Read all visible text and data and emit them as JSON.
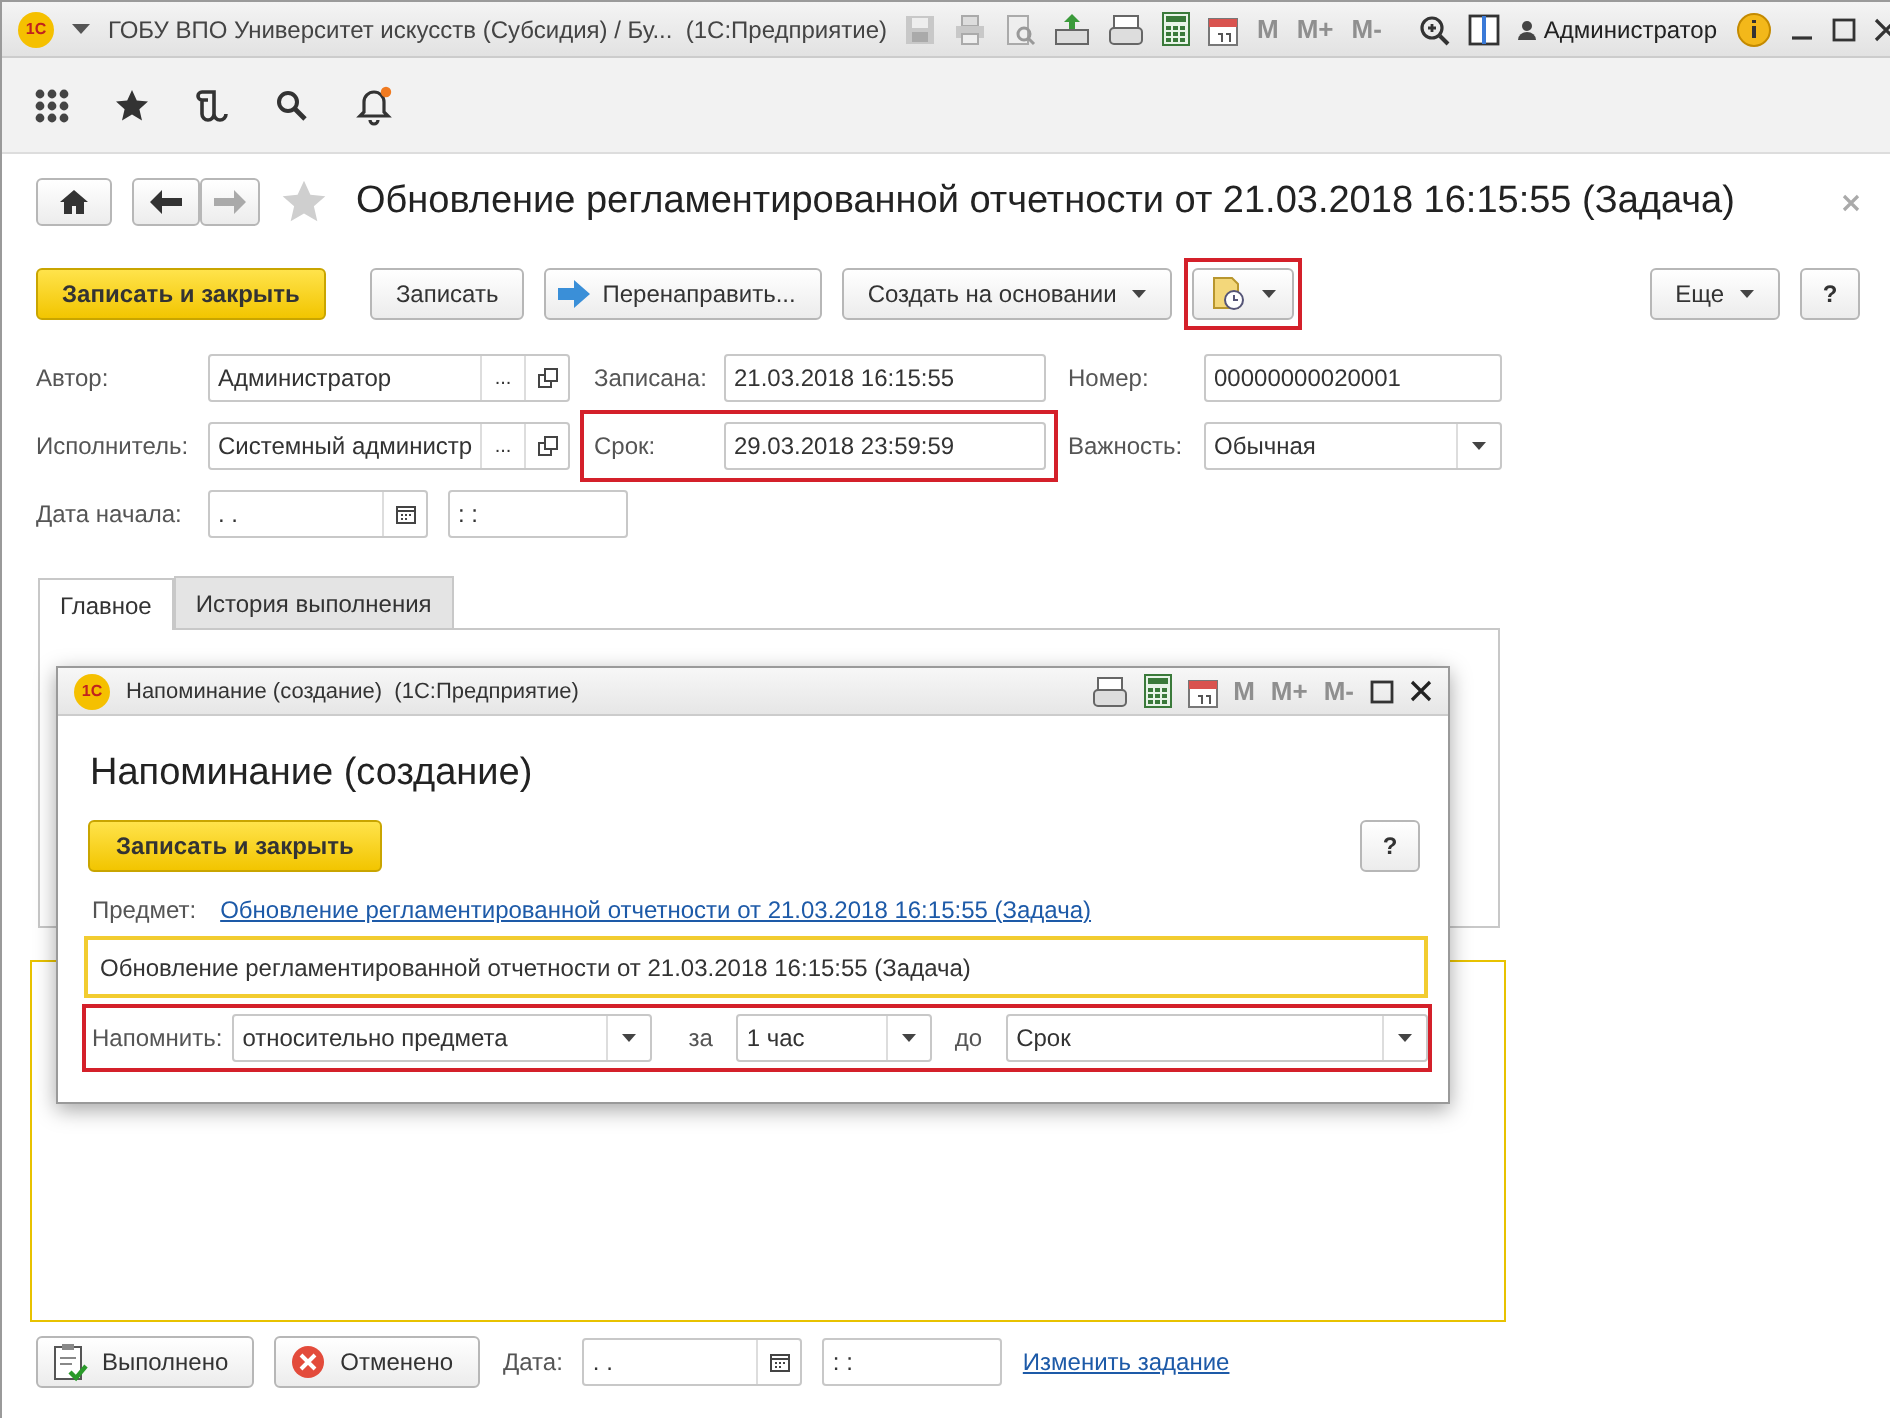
{
  "window": {
    "logo": "1С",
    "title": "ГОБУ ВПО Университет искусств (Субсидия) / Бу...  (1С:Предприятие)",
    "calc_buttons": [
      {
        "label": "M",
        "disabled": true
      },
      {
        "label": "M+",
        "disabled": true
      },
      {
        "label": "M-",
        "disabled": true
      }
    ],
    "user": "Администратор"
  },
  "form": {
    "title": "Обновление регламентированной отчетности от 21.03.2018 16:15:55 (Задача)",
    "buttons": [
      {
        "kind": "primary",
        "label": "Записать и закрыть"
      },
      {
        "kind": "plain",
        "label": "Записать"
      },
      {
        "kind": "forward",
        "label": "Перенаправить..."
      },
      {
        "kind": "dropdown",
        "label": "Создать на основании"
      },
      {
        "kind": "reminder",
        "highlighted": true
      }
    ],
    "more_button": "Еще",
    "help_button": "?",
    "rows": [
      [
        {
          "label": "Автор:",
          "kind": "choice",
          "value": "Администратор",
          "picker": "...",
          "highlighted": false
        },
        {
          "label": "Записана:",
          "kind": "text",
          "value": "21.03.2018 16:15:55",
          "highlighted": false
        },
        {
          "label": "Номер:",
          "kind": "text",
          "value": "00000000020001",
          "highlighted": false
        }
      ],
      [
        {
          "label": "Исполнитель:",
          "kind": "choice",
          "value": "Системный администр",
          "picker": "...",
          "highlighted": false
        },
        {
          "label": "Срок:",
          "kind": "text",
          "value": "29.03.2018 23:59:59",
          "highlighted": true
        },
        {
          "label": "Важность:",
          "kind": "select",
          "value": "Обычная",
          "highlighted": false
        }
      ],
      [
        {
          "label": "Дата начала:",
          "kind": "datetime",
          "value": ".  .",
          "time": ":  :",
          "highlighted": false
        }
      ]
    ],
    "tabs": [
      {
        "label": "Главное",
        "selected": true
      },
      {
        "label": "История выполнения",
        "selected": false
      }
    ],
    "footer": {
      "buttons": [
        {
          "kind": "done",
          "label": "Выполнено"
        },
        {
          "kind": "cancel",
          "label": "Отменено"
        }
      ],
      "date_label": "Дата:",
      "date": ".  .",
      "time": ":  :",
      "link": "Изменить задание"
    }
  },
  "dialog": {
    "logo": "1С",
    "title": "Напоминание (создание)  (1С:Предприятие)",
    "calc_buttons": [
      {
        "label": "M",
        "disabled": true
      },
      {
        "label": "M+",
        "disabled": true
      },
      {
        "label": "M-",
        "disabled": true
      }
    ],
    "heading": "Напоминание (создание)",
    "save_button": "Записать и закрыть",
    "help_button": "?",
    "subject_label": "Предмет:",
    "subject_link": "Обновление регламентированной отчетности от 21.03.2018 16:15:55 (Задача)",
    "text": "Обновление регламентированной отчетности от 21.03.2018 16:15:55 (Задача)",
    "remind": {
      "highlighted": true,
      "label": "Напомнить:",
      "mode": "относительно предмета",
      "before_label": "за",
      "interval": "1 час",
      "until_label": "до",
      "until": "Срок"
    }
  }
}
